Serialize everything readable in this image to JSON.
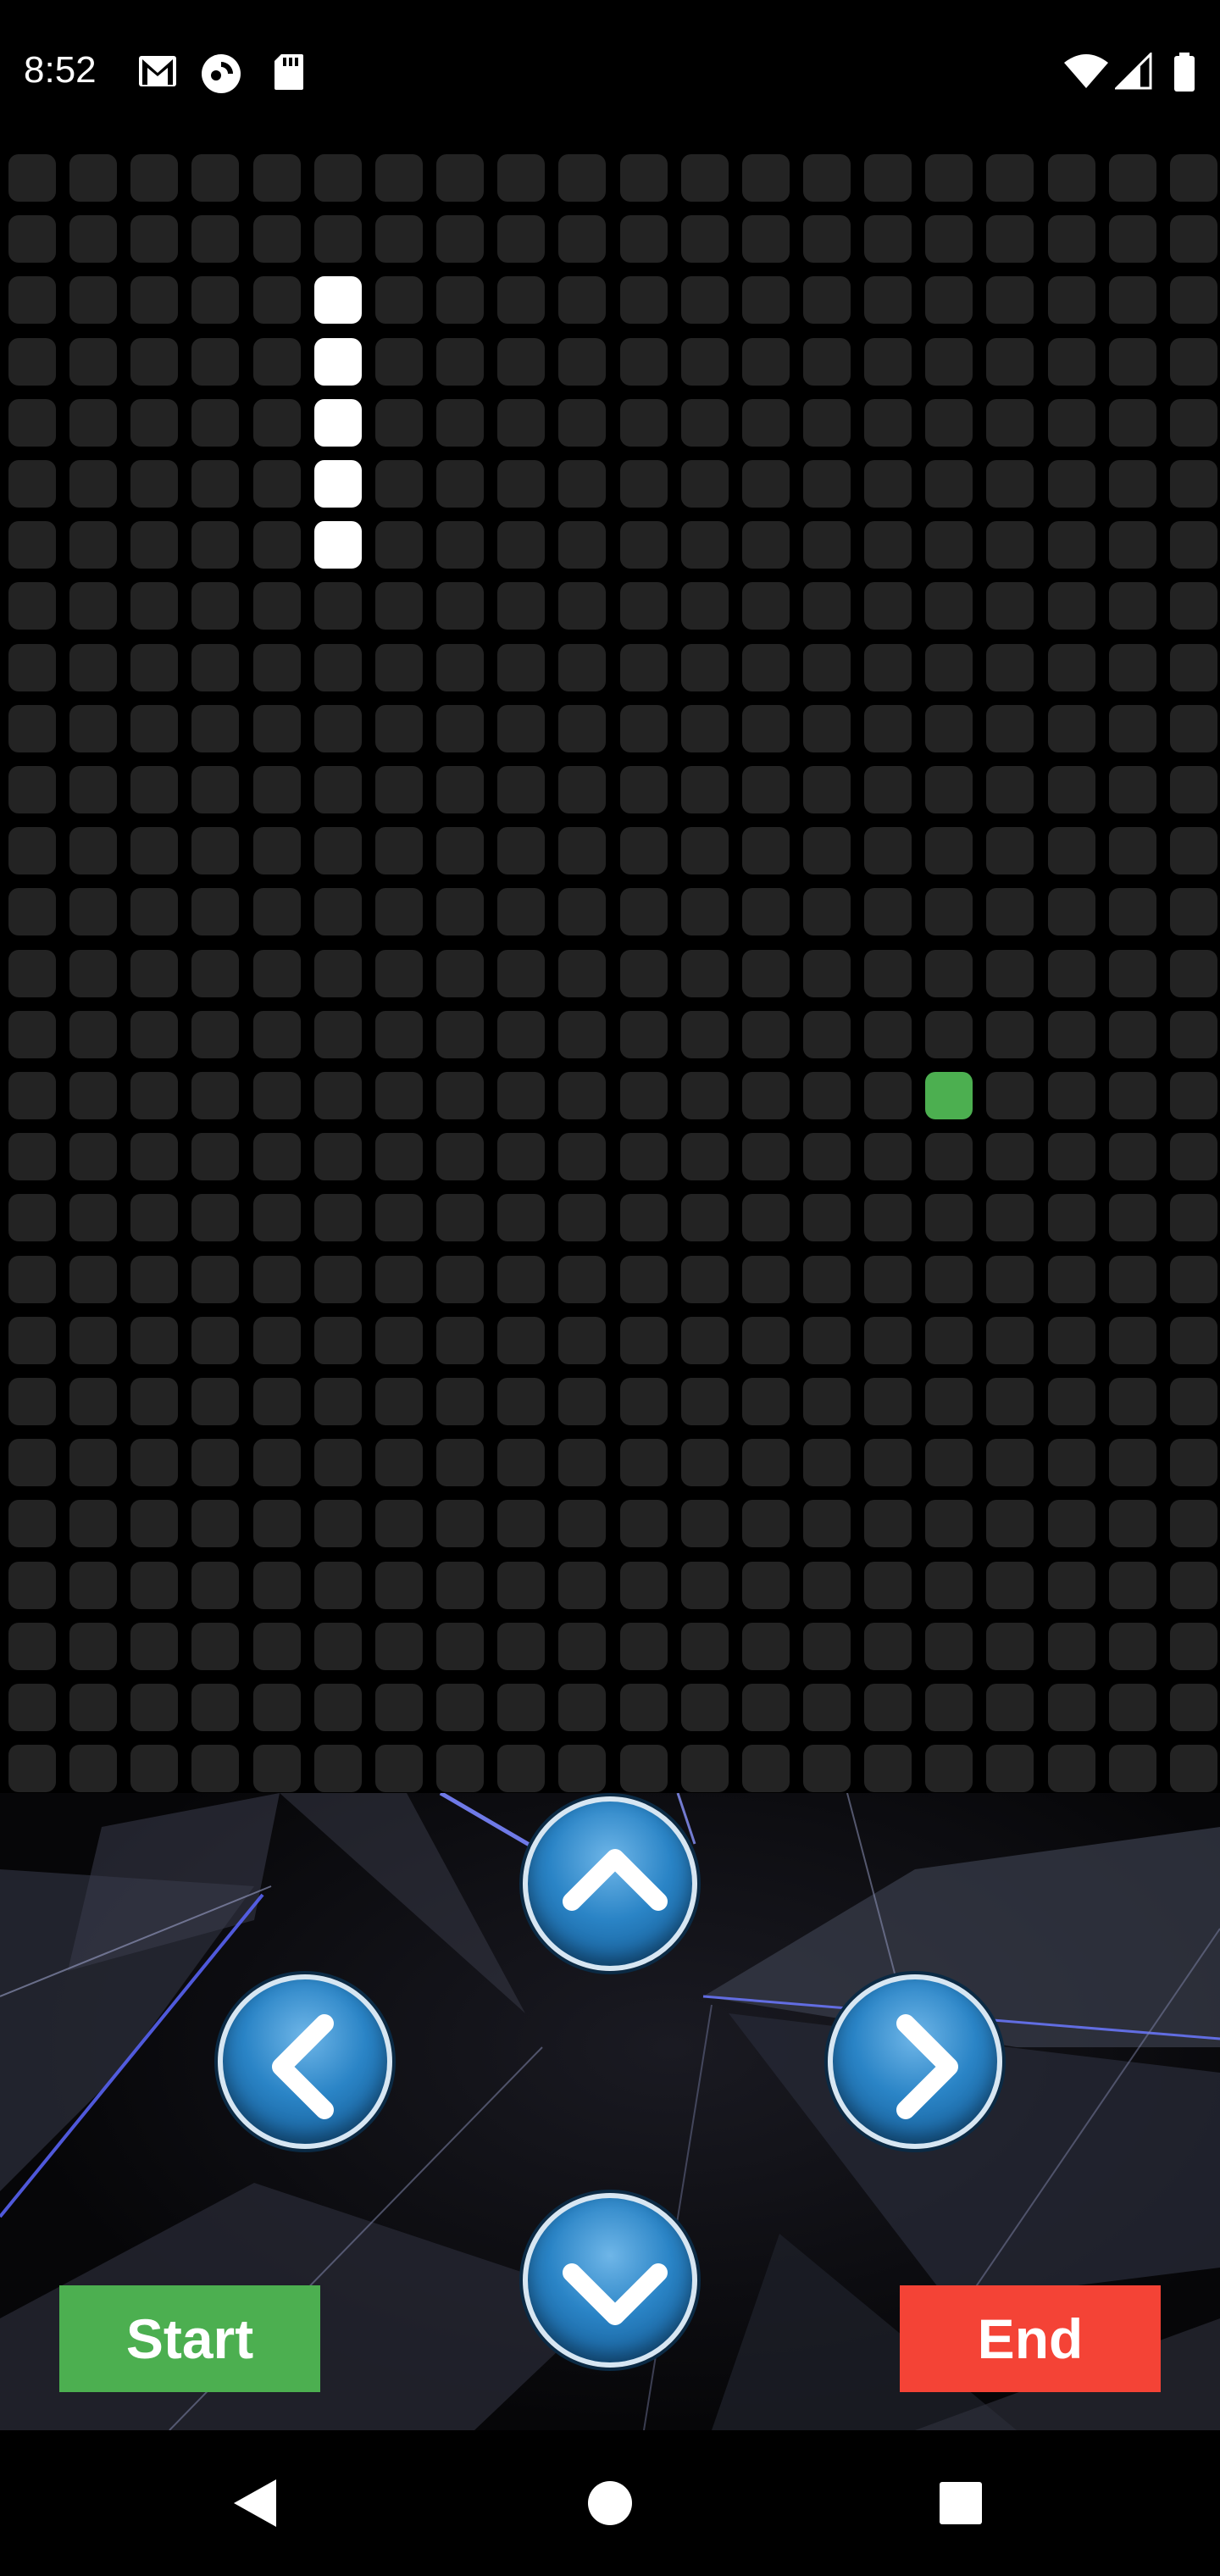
{
  "status_bar": {
    "time": "8:52",
    "left_icons": [
      "gmail-icon",
      "pocket-casts-icon",
      "sd-card-icon"
    ],
    "right_icons": [
      "wifi-icon",
      "cellular-signal-icon",
      "battery-icon"
    ]
  },
  "game": {
    "grid_columns": 20,
    "grid_rows": 27,
    "snake_segments": [
      [
        5,
        2
      ],
      [
        5,
        3
      ],
      [
        5,
        4
      ],
      [
        5,
        5
      ],
      [
        5,
        6
      ]
    ],
    "food": [
      15,
      15
    ],
    "colors": {
      "cell": "#232323",
      "snake": "#ffffff",
      "food": "#4caf50",
      "board": "#000000"
    }
  },
  "controls": {
    "up_icon": "chevron-up-icon",
    "down_icon": "chevron-down-icon",
    "left_icon": "chevron-left-icon",
    "right_icon": "chevron-right-icon",
    "start_label": "Start",
    "end_label": "End",
    "colors": {
      "start": "#4caf50",
      "end": "#f44336",
      "button": "#2a84c6"
    }
  },
  "nav_bar": {
    "back_icon": "back-triangle-icon",
    "home_icon": "home-circle-icon",
    "recents_icon": "recents-square-icon"
  }
}
